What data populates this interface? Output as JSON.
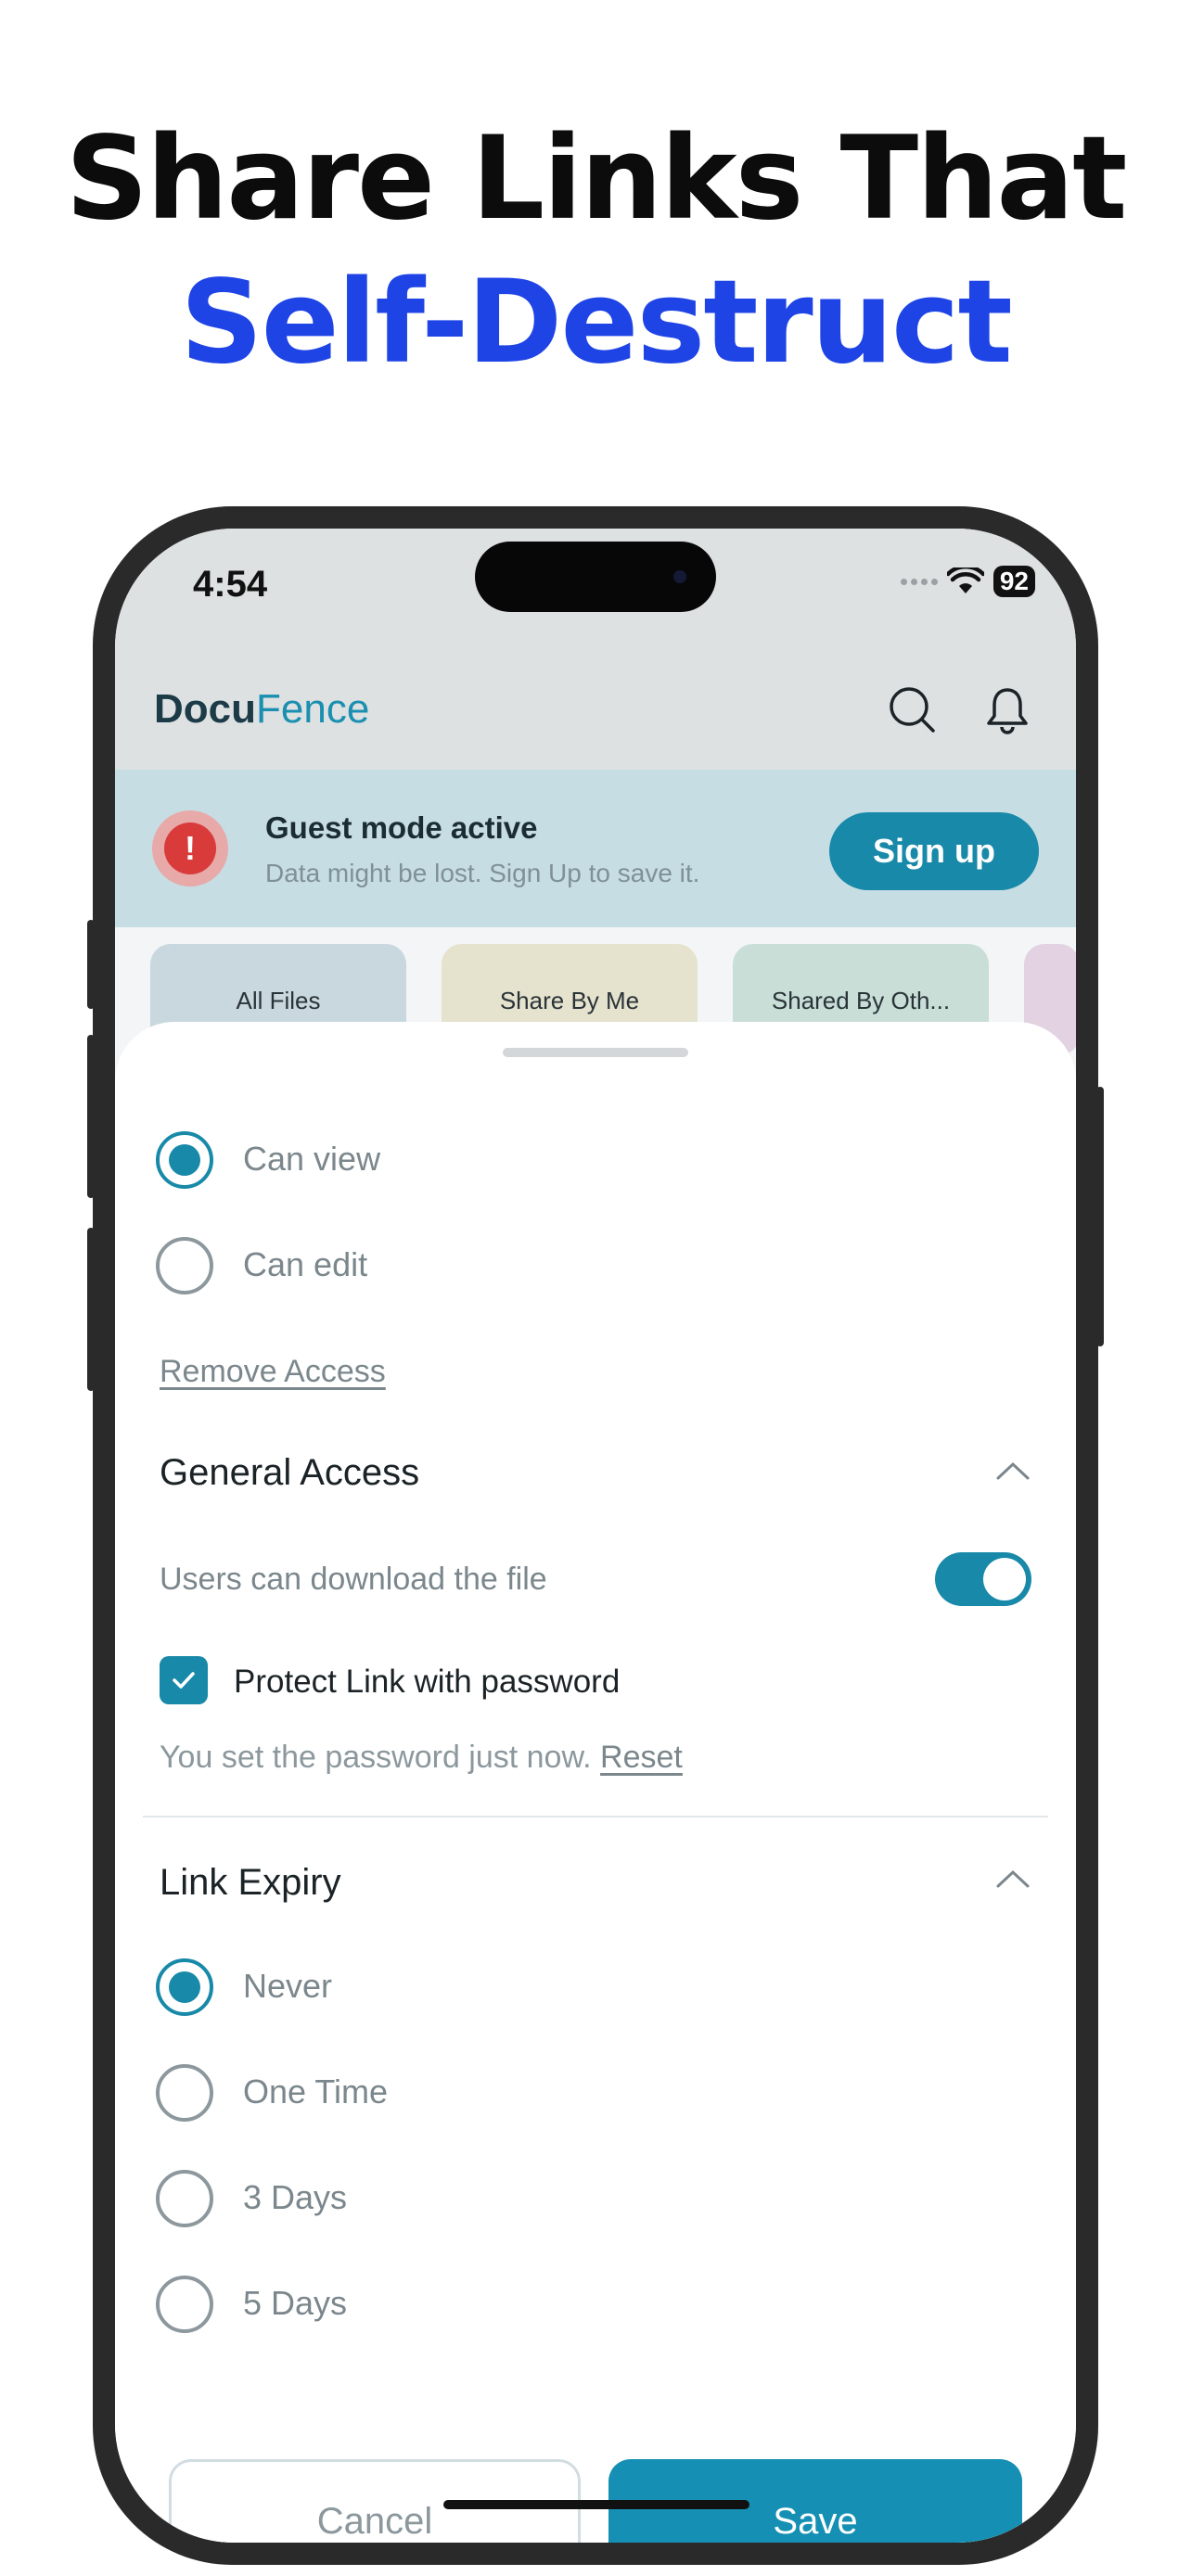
{
  "headline": {
    "line1": "Share Links That",
    "line2": "Self-Destruct"
  },
  "status_bar": {
    "time": "4:54",
    "battery": "92"
  },
  "app": {
    "logo_part1": "Docu",
    "logo_part2": "Fence"
  },
  "guest_banner": {
    "title": "Guest mode active",
    "subtitle": "Data might be lost. Sign Up to save it.",
    "signup_label": "Sign up"
  },
  "categories": [
    "All Files",
    "Share By Me",
    "Shared By Oth..."
  ],
  "permissions": {
    "options": [
      {
        "label": "Can view",
        "selected": true
      },
      {
        "label": "Can edit",
        "selected": false
      }
    ],
    "remove_access": "Remove Access"
  },
  "general_access": {
    "title": "General Access",
    "download_label": "Users can download the file",
    "download_enabled": true,
    "protect_label": "Protect Link with password",
    "protect_checked": true,
    "password_note": "You set the password just now.",
    "reset_label": "Reset"
  },
  "link_expiry": {
    "title": "Link Expiry",
    "options": [
      {
        "label": "Never",
        "selected": true
      },
      {
        "label": "One Time",
        "selected": false
      },
      {
        "label": "3 Days",
        "selected": false
      },
      {
        "label": "5 Days",
        "selected": false
      }
    ]
  },
  "actions": {
    "cancel": "Cancel",
    "save": "Save"
  },
  "colors": {
    "accent": "#1889a8",
    "headline_blue": "#1f44e6",
    "danger": "#d93a3a"
  }
}
